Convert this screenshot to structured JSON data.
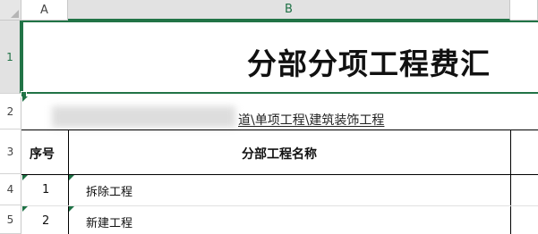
{
  "columns": [
    "A",
    "B"
  ],
  "rows": [
    "1",
    "2",
    "3",
    "4",
    "5"
  ],
  "sheet": {
    "title": "分部分项工程费汇",
    "path_text": "工程\\...\\单项工程\\建筑装饰工程",
    "path_visible_text": "道\\单项工程\\建筑装饰工程",
    "table": {
      "headers": [
        "序号",
        "分部工程名称"
      ],
      "rows": [
        {
          "no": "1",
          "name": "拆除工程"
        },
        {
          "no": "2",
          "name": "新建工程"
        }
      ]
    }
  },
  "colors": {
    "selection": "#217346",
    "header_bg": "#e6e6e6"
  }
}
